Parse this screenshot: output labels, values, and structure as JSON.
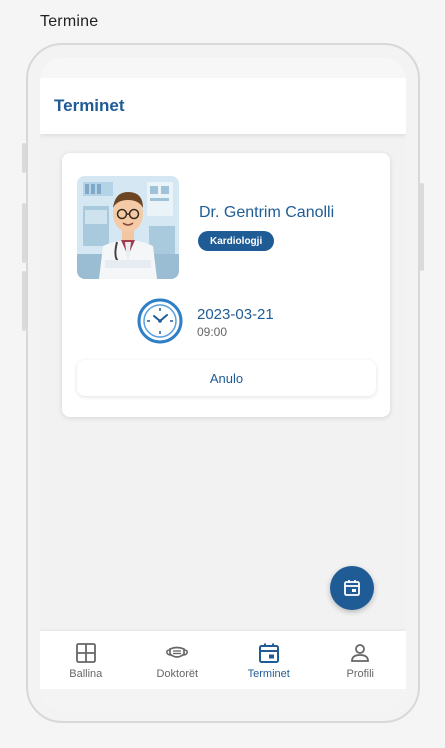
{
  "frame": {
    "label": "Termine"
  },
  "app_bar": {
    "title": "Terminet"
  },
  "appointment": {
    "doctor_name": "Dr. Gentrim Canolli",
    "specialty": "Kardiologji",
    "date": "2023-03-21",
    "time": "09:00",
    "cancel_label": "Anulo"
  },
  "bottom_nav": {
    "items": [
      {
        "label": "Ballina",
        "icon": "grid-icon",
        "active": false
      },
      {
        "label": "Doktorët",
        "icon": "mask-icon",
        "active": false
      },
      {
        "label": "Terminet",
        "icon": "calendar-icon",
        "active": true
      },
      {
        "label": "Profili",
        "icon": "person-icon",
        "active": false
      }
    ]
  },
  "colors": {
    "primary": "#1f5c95",
    "background": "#f2f2f2",
    "inactive": "#666666"
  }
}
